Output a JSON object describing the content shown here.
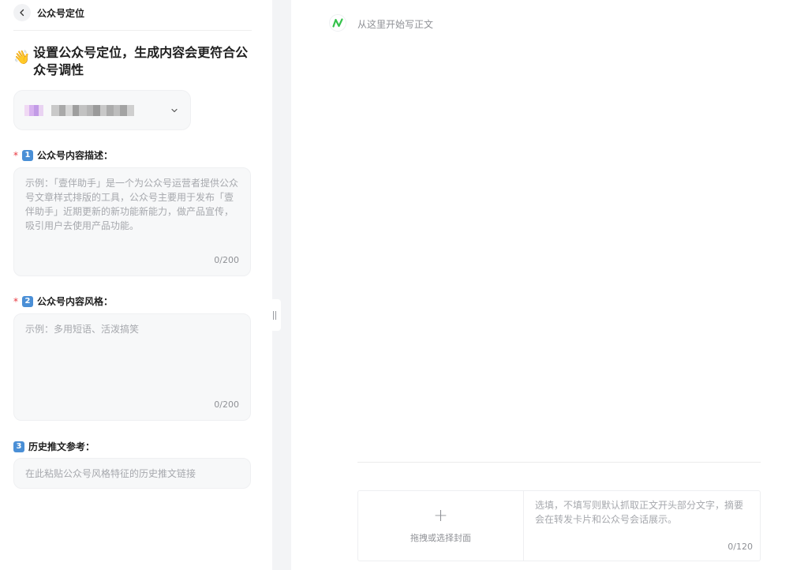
{
  "header": {
    "title": "公众号定位"
  },
  "heading": {
    "emoji": "👋",
    "text": "设置公众号定位，生成内容会更符合公众号调性"
  },
  "account_select": {
    "value_obscured": true
  },
  "fields": [
    {
      "required": "*",
      "number": "1",
      "label": "公众号内容描述：",
      "placeholder": "示例：「壹伴助手」是一个为公众号运营者提供公众号文章样式排版的工具，公众号主要用于发布「壹伴助手」近期更新的新功能新能力，做产品宣传，吸引用户去使用产品功能。",
      "counter": "0/200"
    },
    {
      "required": "*",
      "number": "2",
      "label": "公众号内容风格：",
      "placeholder": "示例：多用短语、活泼搞笑",
      "counter": "0/200"
    },
    {
      "number": "3",
      "label": "历史推文参考：",
      "placeholder": "在此粘贴公众号风格特征的历史推文链接"
    }
  ],
  "editor": {
    "placeholder": "从这里开始写正文",
    "cover_label": "拖拽或选择封面",
    "summary_placeholder": "选填，不填写则默认抓取正文开头部分文字，摘要会在转发卡片和公众号会话展示。",
    "summary_counter": "0/120"
  },
  "colors": {
    "accent": "#4a8fd6",
    "required": "#e8373e",
    "logo_green": "#35c24b"
  }
}
